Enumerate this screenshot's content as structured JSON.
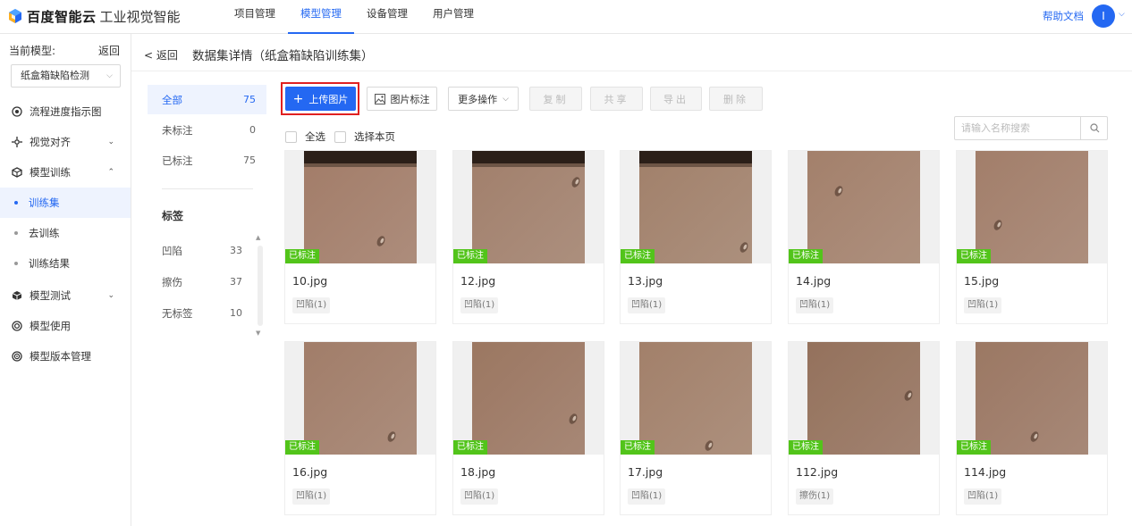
{
  "brand": {
    "name": "百度智能云",
    "product": "工业视觉智能"
  },
  "nav": {
    "items": [
      "项目管理",
      "模型管理",
      "设备管理",
      "用户管理"
    ],
    "active_index": 1
  },
  "help_label": "帮助文档",
  "avatar_initial": "I",
  "sidebar": {
    "current_model_label": "当前模型:",
    "back_label": "返回",
    "selected_model": "纸盒箱缺陷检测",
    "items": [
      {
        "label": "流程进度指示图",
        "icon": "target-icon"
      },
      {
        "label": "视觉对齐",
        "icon": "align-icon",
        "expand": "collapsed"
      },
      {
        "label": "模型训练",
        "icon": "cube-icon",
        "expand": "expanded"
      },
      {
        "label": "模型测试",
        "icon": "cube-test-icon",
        "expand": "collapsed"
      },
      {
        "label": "模型使用",
        "icon": "gear-icon"
      },
      {
        "label": "模型版本管理",
        "icon": "version-icon"
      }
    ],
    "sub_items": [
      "训练集",
      "去训练",
      "训练结果"
    ],
    "active_sub": 0
  },
  "header": {
    "back_label": "返回",
    "title": "数据集详情（纸盒箱缺陷训练集）"
  },
  "filters": {
    "status": [
      {
        "label": "全部",
        "count": "75"
      },
      {
        "label": "未标注",
        "count": "0"
      },
      {
        "label": "已标注",
        "count": "75"
      }
    ],
    "active_status": 0,
    "tags_title": "标签",
    "tags": [
      {
        "label": "凹陷",
        "count": "33"
      },
      {
        "label": "擦伤",
        "count": "37"
      },
      {
        "label": "无标签",
        "count": "10"
      }
    ]
  },
  "toolbar": {
    "upload": "上传图片",
    "annotate": "图片标注",
    "more": "更多操作",
    "copy": "复制",
    "share": "共享",
    "export": "导出",
    "delete": "删除",
    "select_all": "全选",
    "select_page": "选择本页",
    "search_placeholder": "请输入名称搜索"
  },
  "badge_label": "已标注",
  "images": [
    {
      "name": "10.jpg",
      "tag": "凹陷(1)",
      "base": "#a9826d",
      "top_dark": true,
      "spot": [
        0.68,
        0.8
      ]
    },
    {
      "name": "12.jpg",
      "tag": "凹陷(1)",
      "base": "#a88570",
      "top_dark": true,
      "spot": [
        0.92,
        0.28
      ]
    },
    {
      "name": "13.jpg",
      "tag": "凹陷(1)",
      "base": "#a8866f",
      "top_dark": true,
      "spot": [
        0.93,
        0.86
      ]
    },
    {
      "name": "14.jpg",
      "tag": "凹陷(1)",
      "base": "#aa8670",
      "top_dark": false,
      "spot": [
        0.28,
        0.36
      ]
    },
    {
      "name": "15.jpg",
      "tag": "凹陷(1)",
      "base": "#a9846f",
      "top_dark": false,
      "spot": [
        0.2,
        0.66
      ]
    },
    {
      "name": "16.jpg",
      "tag": "凹陷(1)",
      "base": "#a8836e",
      "top_dark": false,
      "spot": [
        0.78,
        0.84
      ]
    },
    {
      "name": "18.jpg",
      "tag": "凹陷(1)",
      "base": "#a27c66",
      "top_dark": false,
      "spot": [
        0.9,
        0.68
      ]
    },
    {
      "name": "17.jpg",
      "tag": "凹陷(1)",
      "base": "#a9866f",
      "top_dark": false,
      "spot": [
        0.62,
        0.92
      ]
    },
    {
      "name": "112.jpg",
      "tag": "擦伤(1)",
      "base": "#9b7660",
      "top_dark": false,
      "spot": [
        0.9,
        0.48
      ]
    },
    {
      "name": "114.jpg",
      "tag": "凹陷(1)",
      "base": "#a27d68",
      "top_dark": false,
      "spot": [
        0.52,
        0.84
      ]
    }
  ]
}
